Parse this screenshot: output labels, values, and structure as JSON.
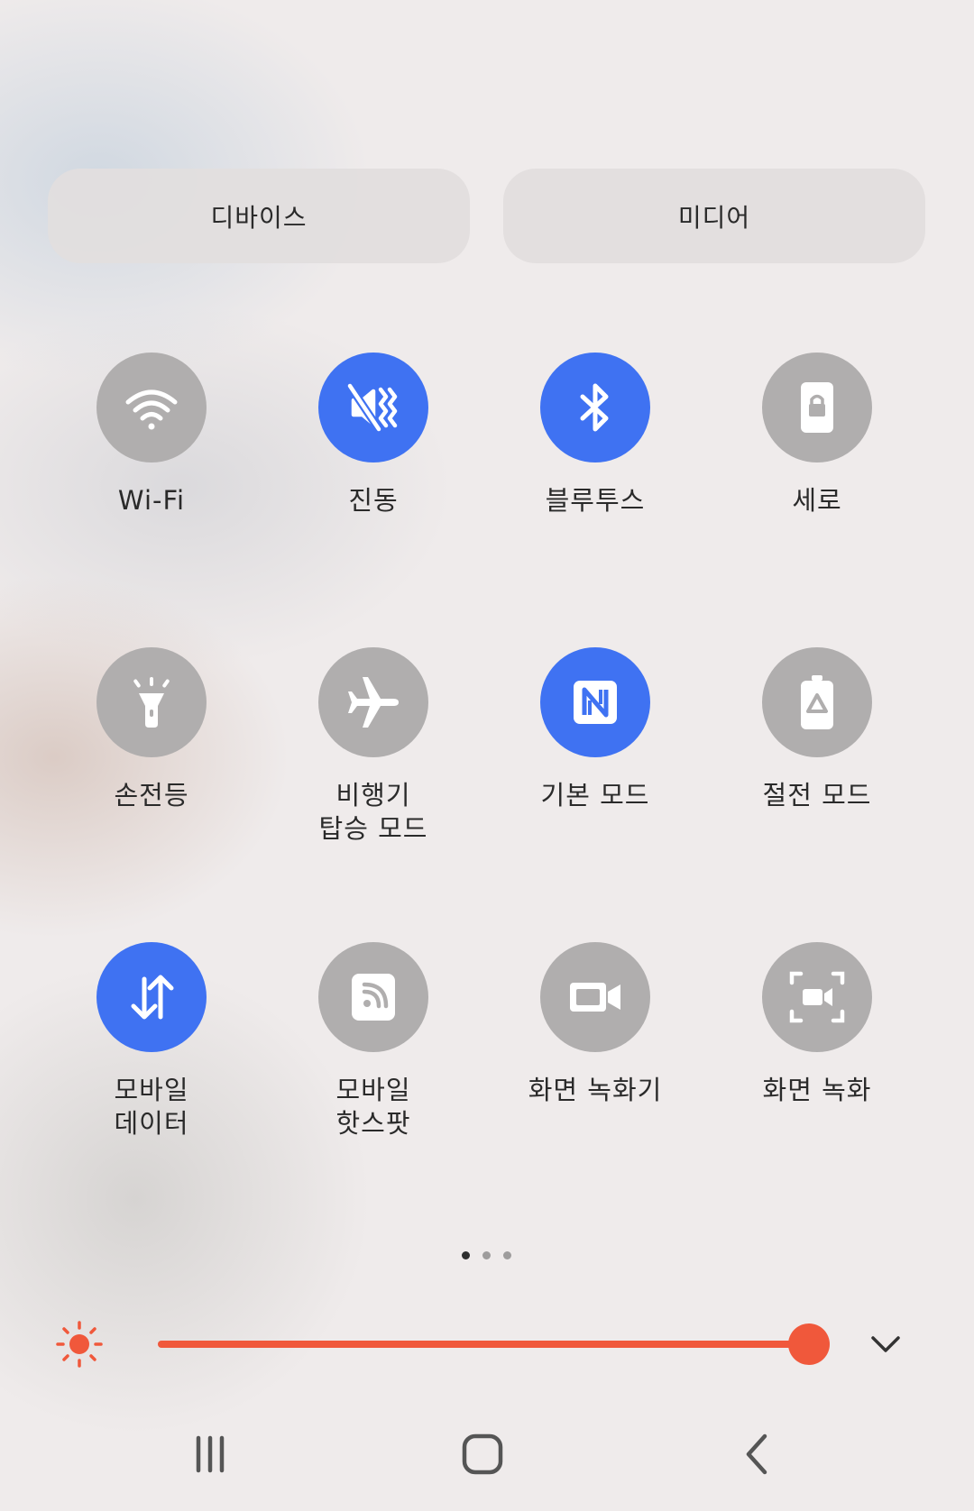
{
  "top_buttons": {
    "devices": "디바이스",
    "media": "미디어"
  },
  "tiles": [
    {
      "label": "Wi-Fi",
      "icon": "wifi-icon",
      "active": false
    },
    {
      "label": "진동",
      "icon": "vibrate-icon",
      "active": true
    },
    {
      "label": "블루투스",
      "icon": "bluetooth-icon",
      "active": true
    },
    {
      "label": "세로",
      "icon": "portrait-lock-icon",
      "active": false
    },
    {
      "label": "손전등",
      "icon": "flashlight-icon",
      "active": false
    },
    {
      "label": "비행기\n탑승 모드",
      "icon": "airplane-icon",
      "active": false
    },
    {
      "label": "기본 모드",
      "icon": "nfc-icon",
      "active": true
    },
    {
      "label": "절전 모드",
      "icon": "power-saving-icon",
      "active": false
    },
    {
      "label": "모바일\n데이터",
      "icon": "mobile-data-icon",
      "active": true
    },
    {
      "label": "모바일\n핫스팟",
      "icon": "hotspot-icon",
      "active": false
    },
    {
      "label": "화면 녹화기",
      "icon": "video-camera-icon",
      "active": false
    },
    {
      "label": "화면 녹화",
      "icon": "screen-record-icon",
      "active": false
    }
  ],
  "pagination": {
    "total": 3,
    "current": 0
  },
  "brightness": {
    "level": 1.0,
    "accent": "#f0583b"
  },
  "colors": {
    "active_tile": "#3f72f2",
    "inactive_tile": "#b0aeae"
  }
}
